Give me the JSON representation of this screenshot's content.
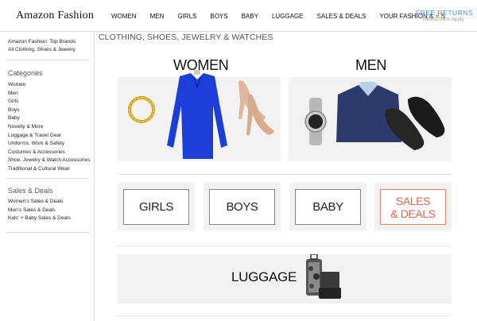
{
  "header": {
    "logo": "Amazon Fashion",
    "nav": [
      "WOMEN",
      "MEN",
      "GIRLS",
      "BOYS",
      "BABY",
      "LUGGAGE",
      "SALES & DEALS",
      "YOUR FASHION &",
      "S"
    ],
    "returns_title": "FREE RETURNS",
    "returns_sub": "Restrictions Apply"
  },
  "sidebar": {
    "top_links": [
      "Amazon Fashion: Top Brands",
      "All Clothing, Shoes & Jewelry"
    ],
    "categories_title": "Categories",
    "categories": [
      "Women",
      "Men",
      "Girls",
      "Boys",
      "Baby",
      "Novelty & More",
      "Luggage & Travel Gear",
      "Uniforms, Work & Safety",
      "Costumes & Accessories",
      "Shoe, Jewelry & Watch Accessories",
      "Traditional & Cultural Wear"
    ],
    "sales_title": "Sales & Deals",
    "sales": [
      "Women's Sales & Deals",
      "Men's Sales & Deals",
      "Kids' + Baby Sales & Deals"
    ]
  },
  "main": {
    "title": "CLOTHING, SHOES, JEWELRY & WATCHES",
    "women_label": "WOMEN",
    "men_label": "MEN",
    "tiles": [
      "GIRLS",
      "BOYS",
      "BABY"
    ],
    "sales_line1": "SALES",
    "sales_line2": "& DEALS",
    "luggage_label": "LUGGAGE"
  },
  "colors": {
    "accent": "#3a8dde",
    "sales": "#e0644a",
    "heart": "#f0a21c"
  }
}
